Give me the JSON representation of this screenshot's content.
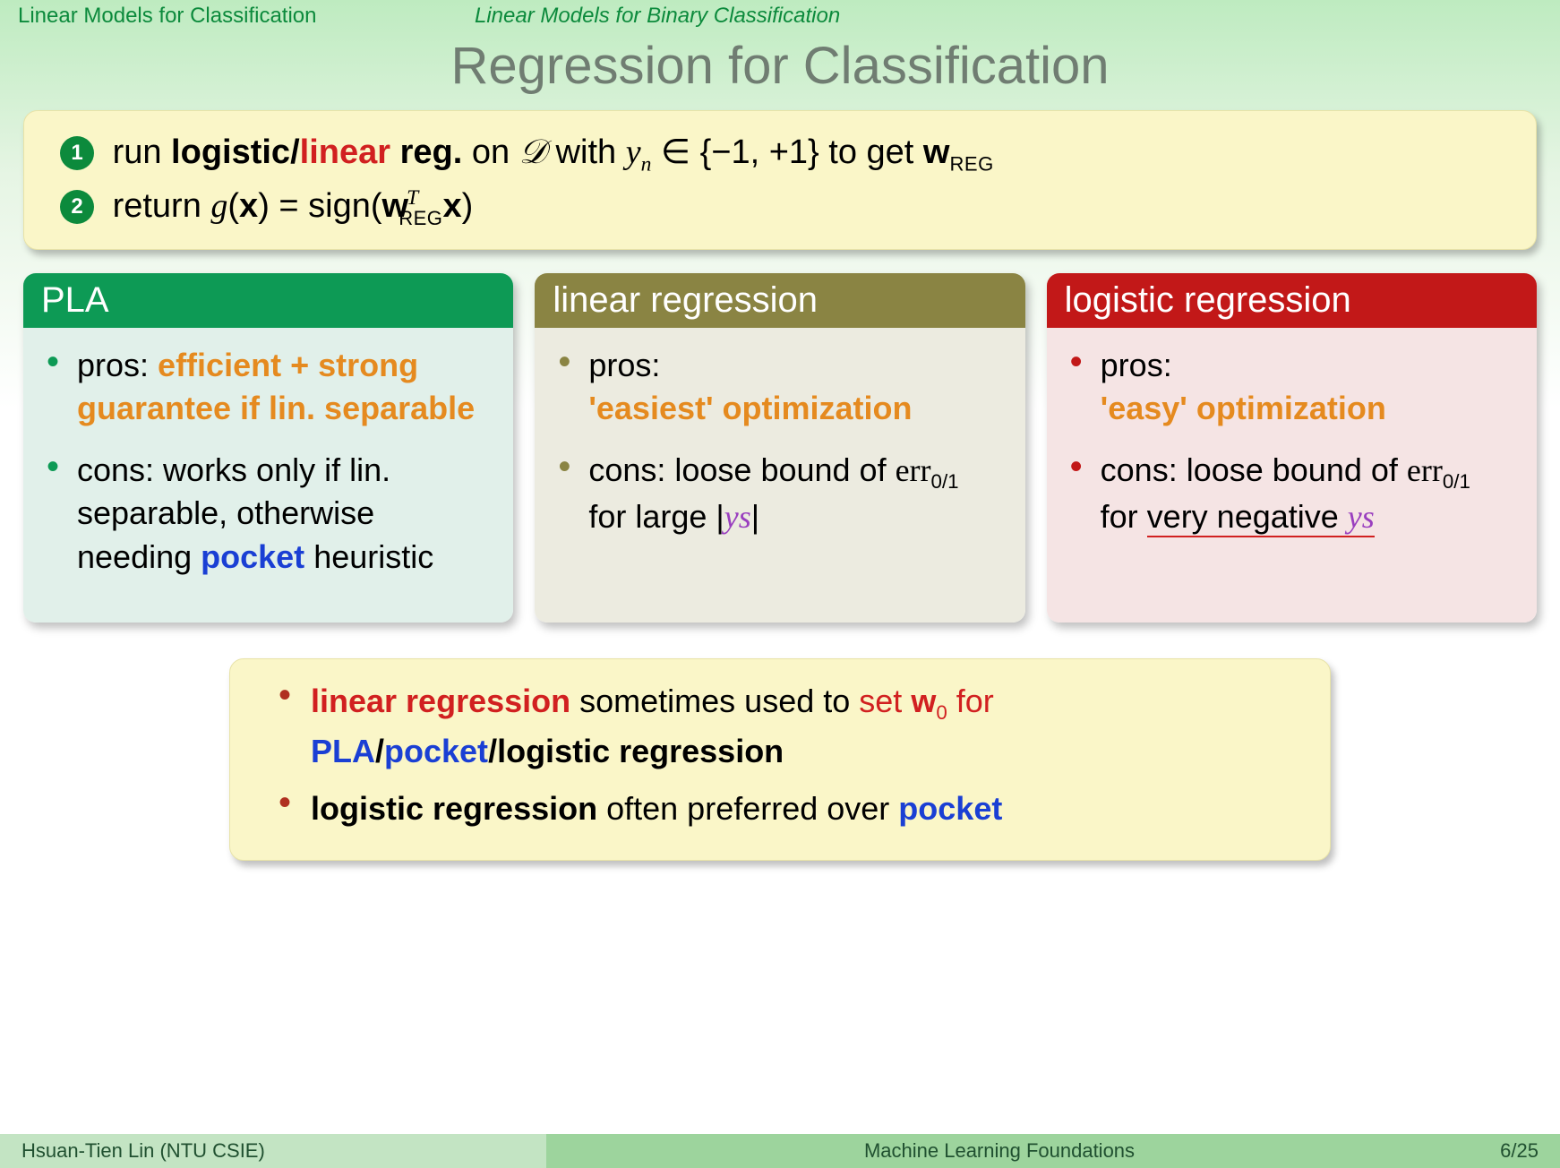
{
  "breadcrumb": {
    "section": "Linear Models for Classification",
    "subsection": "Linear Models for Binary Classification"
  },
  "title": "Regression for Classification",
  "algo": {
    "step1_prefix": "run ",
    "step1_logistic": "logistic",
    "step1_slash": "/",
    "step1_linear": "linear",
    "step1_reg": " reg.",
    "step1_on": " on ",
    "step1_D": "𝒟",
    "step1_with": " with ",
    "step1_yn": "y",
    "step1_n": "n",
    "step1_in": " ∈ {−1, +1} to get ",
    "step1_w": "w",
    "step1_REG": "REG",
    "step2_return": "return ",
    "step2_g": "g",
    "step2_open": "(",
    "step2_x": "x",
    "step2_eq": ") = sign(",
    "step2_w": "w",
    "step2_T": "T",
    "step2_REG": "REG",
    "step2_x2": "x",
    "step2_close": ")"
  },
  "cards": {
    "pla": {
      "title": "PLA",
      "pros_label": "pros: ",
      "pros": "efficient + strong guarantee if lin. separable",
      "cons_label": "cons: ",
      "cons_a": "works only if lin. separable, otherwise needing ",
      "cons_pocket": "pocket",
      "cons_b": " heuristic"
    },
    "lin": {
      "title": "linear regression",
      "pros_label": "pros: ",
      "pros": "'easiest' optimization",
      "cons_label": "cons: ",
      "cons_a": "loose bound of ",
      "cons_err": "err",
      "cons_sub": "0/1",
      "cons_b": " for large |",
      "cons_ys": "ys",
      "cons_c": "|"
    },
    "log": {
      "title": "logistic regression",
      "pros_label": "pros: ",
      "pros": "'easy' optimization",
      "cons_label": "cons: ",
      "cons_a": "loose bound of ",
      "cons_err": "err",
      "cons_sub": "0/1",
      "cons_b": " for ",
      "cons_neg": "very negative ",
      "cons_ys": "ys"
    }
  },
  "summary": {
    "l1_a": "linear regression",
    "l1_b": " sometimes used to ",
    "l1_set": "set ",
    "l1_w": "w",
    "l1_0": "0",
    "l1_for": " for ",
    "l1_pla": "PLA",
    "l1_s1": "/",
    "l1_pocket": "pocket",
    "l1_s2": "/",
    "l1_logreg": "logistic regression",
    "l2_a": "logistic regression",
    "l2_b": " often preferred over ",
    "l2_pocket": "pocket"
  },
  "footer": {
    "author": "Hsuan-Tien Lin (NTU CSIE)",
    "course": "Machine Learning Foundations",
    "page": "6/25"
  }
}
